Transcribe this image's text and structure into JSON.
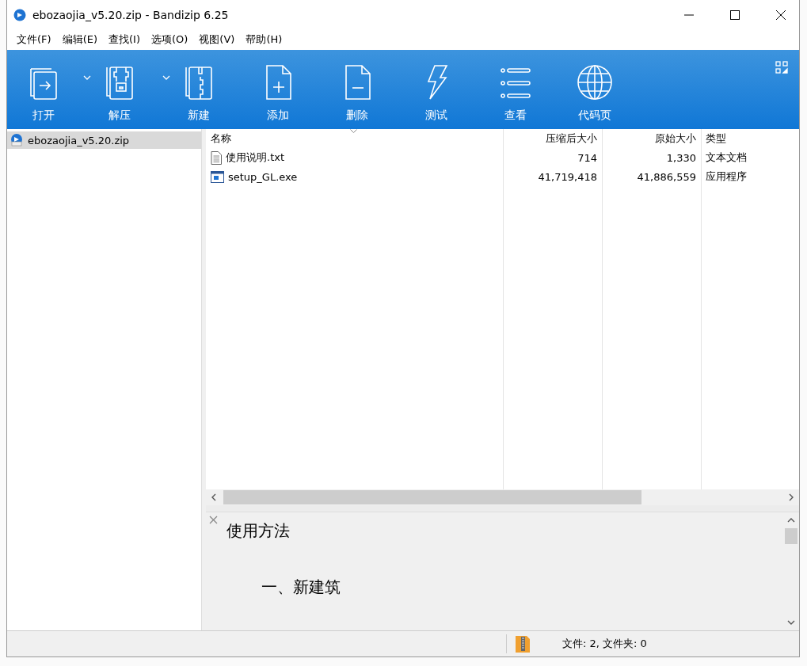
{
  "window": {
    "title": "ebozaojia_v5.20.zip - Bandizip 6.25"
  },
  "menu": [
    "文件(F)",
    "编辑(E)",
    "查找(I)",
    "选项(O)",
    "视图(V)",
    "帮助(H)"
  ],
  "toolbar": [
    {
      "label": "打开",
      "kind": "open",
      "dropdown": true
    },
    {
      "label": "解压",
      "kind": "extract",
      "dropdown": true
    },
    {
      "label": "新建",
      "kind": "new",
      "dropdown": false
    },
    {
      "label": "添加",
      "kind": "add",
      "dropdown": false
    },
    {
      "label": "删除",
      "kind": "delete",
      "dropdown": false
    },
    {
      "label": "测试",
      "kind": "test",
      "dropdown": false
    },
    {
      "label": "查看",
      "kind": "view",
      "dropdown": false
    },
    {
      "label": "代码页",
      "kind": "codepage",
      "dropdown": false
    }
  ],
  "tree": [
    {
      "label": "ebozaojia_v5.20.zip",
      "selected": true
    }
  ],
  "table": {
    "columns": [
      {
        "label": "名称",
        "sorted": true
      },
      {
        "label": "压缩后大小",
        "sorted": false
      },
      {
        "label": "原始大小",
        "sorted": false
      },
      {
        "label": "类型",
        "sorted": false
      }
    ],
    "rows": [
      {
        "kind": "text",
        "cells": [
          "使用说明.txt",
          "714",
          "1,330",
          "文本文档"
        ]
      },
      {
        "kind": "exe",
        "cells": [
          "setup_GL.exe",
          "41,719,418",
          "41,886,559",
          "应用程序"
        ]
      }
    ]
  },
  "preview": {
    "heading": "使用方法",
    "subheading": "一、新建筑"
  },
  "status_bar": {
    "text": "文件: 2, 文件夹: 0"
  }
}
